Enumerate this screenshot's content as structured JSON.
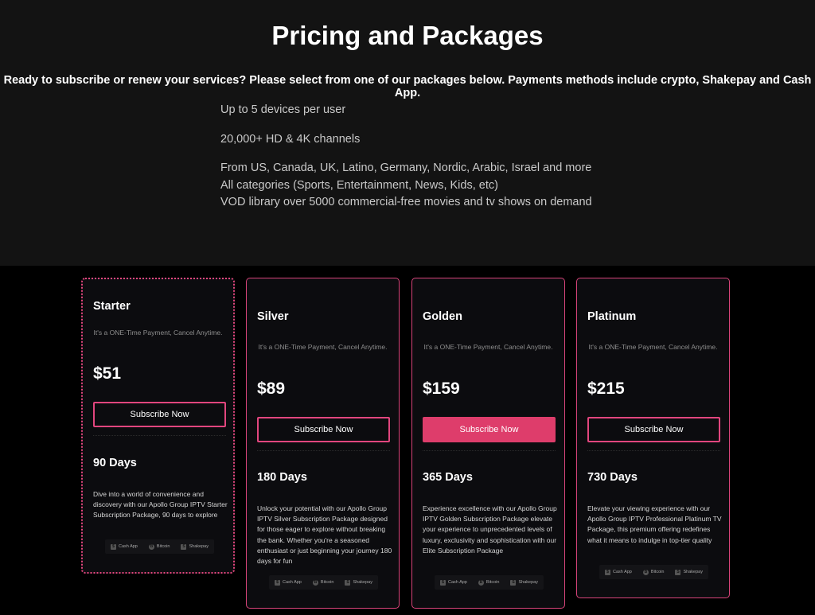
{
  "page": {
    "title": "Pricing and Packages",
    "subtitle": "Ready to subscribe or renew your services? Please select from one of our packages below. Payments methods include crypto, Shakepay and Cash App."
  },
  "features": {
    "line1": "Up to 5 devices per user",
    "line2": "20,000+ HD & 4K channels",
    "line3": "From US, Canada, UK, Latino, Germany, Nordic, Arabic, Israel and more",
    "line4": "All categories (Sports, Entertainment, News, Kids, etc)",
    "line5": "VOD library over 5000 commercial-free movies and tv shows on demand"
  },
  "plans": [
    {
      "name": "Starter",
      "note": "It's a ONE-Time Payment, Cancel Anytime.",
      "price": "$51",
      "button": "Subscribe Now",
      "days": "90 Days",
      "description": "Dive into a world of convenience and discovery with our Apollo Group IPTV Starter Subscription Package, 90 days to explore"
    },
    {
      "name": "Silver",
      "note": "It's a ONE-Time Payment, Cancel Anytime.",
      "price": "$89",
      "button": "Subscribe Now",
      "days": "180 Days",
      "description": "Unlock your potential with our Apollo Group IPTV Silver Subscription Package designed for those eager to explore without breaking the bank. Whether you're a seasoned enthusiast or just beginning your journey 180 days for fun"
    },
    {
      "name": "Golden",
      "note": "It's a ONE-Time Payment, Cancel Anytime.",
      "price": "$159",
      "button": "Subscribe Now",
      "days": "365 Days",
      "description": "Experience excellence with our Apollo Group IPTV Golden Subscription Package elevate your experience to unprecedented levels of luxury, exclusivity and sophistication with our Elite Subscription Package"
    },
    {
      "name": "Platinum",
      "note": "It's a ONE-Time Payment, Cancel Anytime.",
      "price": "$215",
      "button": "Subscribe Now",
      "days": "730 Days",
      "description": "Elevate your viewing experience with our Apollo Group IPTV Professional Platinum TV Package, this premium offering redefines what it means to indulge in top-tier quality"
    }
  ],
  "payment_methods": {
    "cashapp": "Cash App",
    "bitcoin": "Bitcoin",
    "shakepay": "Shakepay",
    "cashapp_glyph": "$",
    "bitcoin_glyph": "B",
    "shakepay_glyph": "S"
  },
  "colors": {
    "accent": "#de3d6b",
    "top_background": "#131313",
    "page_background": "#000000",
    "card_background": "#0c0c0f"
  }
}
